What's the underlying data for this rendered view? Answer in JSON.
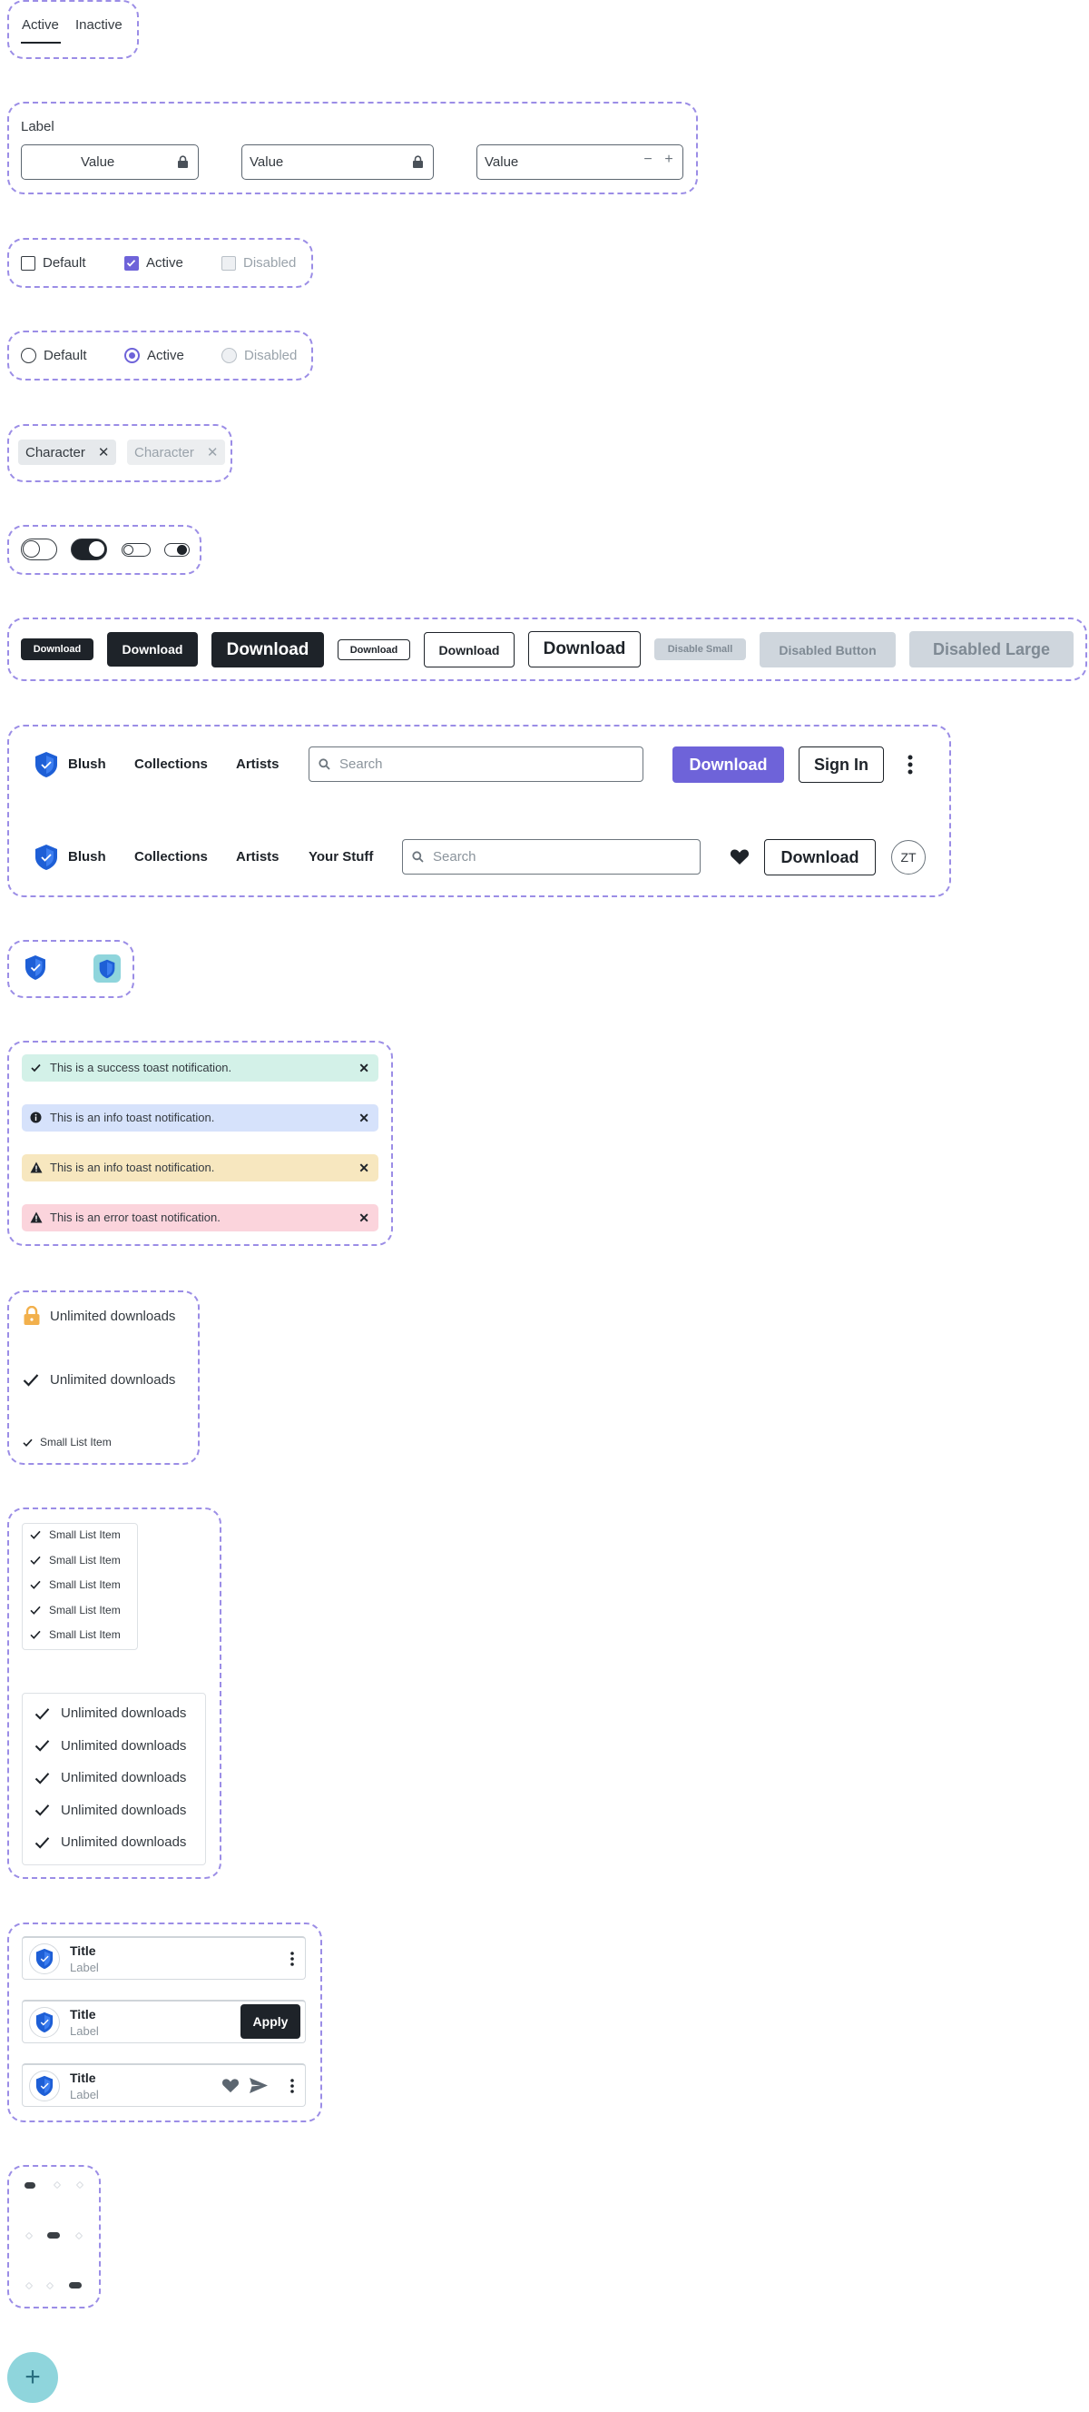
{
  "tabs": {
    "items": [
      "Active",
      "Inactive"
    ]
  },
  "inputs": {
    "label": "Label",
    "field1_value": "Value",
    "field2_value": "Value",
    "field3_value": "Value",
    "stepper_minus": "−",
    "stepper_plus": "+"
  },
  "checkboxes": {
    "default": "Default",
    "active": "Active",
    "disabled": "Disabled"
  },
  "radios": {
    "default": "Default",
    "active": "Active",
    "disabled": "Disabled"
  },
  "chips": {
    "chip1": "Character",
    "chip2": "Character",
    "close_glyph": "✕"
  },
  "buttons": {
    "small": "Download",
    "medium": "Download",
    "large": "Download",
    "outline_small": "Download",
    "outline_medium": "Download",
    "outline_large": "Download",
    "disabled_small": "Disable Small",
    "disabled_medium": "Disabled Button",
    "disabled_large": "Disabled Large"
  },
  "navbar1": {
    "brand": "Blush",
    "links": [
      "Collections",
      "Artists"
    ],
    "search_placeholder": "Search",
    "download": "Download",
    "sign_in": "Sign In"
  },
  "navbar2": {
    "brand": "Blush",
    "links": [
      "Collections",
      "Artists",
      "Your Stuff"
    ],
    "search_placeholder": "Search",
    "download": "Download",
    "avatar_initials": "ZT"
  },
  "toasts": [
    {
      "type": "success",
      "text": "This is a success toast notification.",
      "color": "#d3f1e8"
    },
    {
      "type": "info",
      "text": "This is an info toast notification.",
      "color": "#d6e2fb"
    },
    {
      "type": "warning",
      "text": "This is an info toast notification.",
      "color": "#f7e7bf"
    },
    {
      "type": "error",
      "text": "This is an error toast notification.",
      "color": "#fbd4dc"
    }
  ],
  "list_items": {
    "lock_item": "Unlimited downloads",
    "check_item": "Unlimited downloads",
    "small_item": "Small List Item"
  },
  "small_list": [
    "Small List Item",
    "Small List Item",
    "Small List Item",
    "Small List Item",
    "Small List Item"
  ],
  "large_list": [
    "Unlimited downloads",
    "Unlimited downloads",
    "Unlimited downloads",
    "Unlimited downloads",
    "Unlimited downloads"
  ],
  "cards": [
    {
      "title": "Title",
      "label": "Label"
    },
    {
      "title": "Title",
      "label": "Label",
      "action": "Apply"
    },
    {
      "title": "Title",
      "label": "Label"
    }
  ],
  "fab": {
    "glyph": "+"
  },
  "colors": {
    "accent": "#6e63d9",
    "brand_blue": "#1e5fd6",
    "dark": "#1e2329",
    "frame": "#9b8de6",
    "fab": "#8fd5dc"
  }
}
